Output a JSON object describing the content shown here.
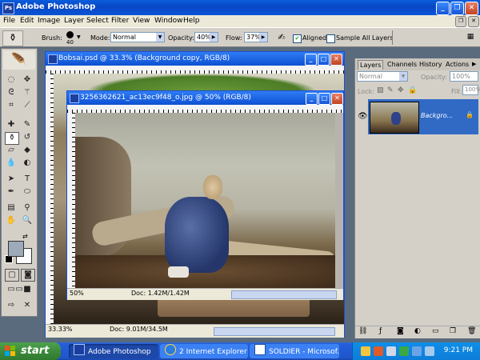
{
  "app": {
    "title": "Adobe Photoshop",
    "icon": "photoshop-icon"
  },
  "menu": [
    "File",
    "Edit",
    "Image",
    "Layer",
    "Select",
    "Filter",
    "View",
    "Window",
    "Help"
  ],
  "options": {
    "brush_label": "Brush:",
    "brush_size": "40",
    "mode_label": "Mode:",
    "mode_value": "Normal",
    "opacity_label": "Opacity:",
    "opacity_value": "40%",
    "flow_label": "Flow:",
    "flow_value": "37%",
    "aligned_label": "Aligned",
    "aligned_checked": true,
    "sample_all_label": "Sample All Layers",
    "sample_all_checked": false
  },
  "doc_back": {
    "title": "Bobsai.psd @ 33.3% (Background copy, RGB/8)",
    "zoom": "33.33%",
    "doc_info": "Doc: 9.01M/34.5M"
  },
  "doc_front": {
    "title": "3256362621_ac13ec9f48_o.jpg @ 50% (RGB/8)",
    "zoom": "50%",
    "doc_info": "Doc: 1.42M/1.42M"
  },
  "layers_panel": {
    "tabs": [
      "Layers",
      "Channels",
      "History",
      "Actions"
    ],
    "active_tab": "Layers",
    "blend_mode": "Normal",
    "opacity_label": "Opacity:",
    "opacity_value": "100%",
    "lock_label": "Lock:",
    "fill_label": "Fill:",
    "fill_value": "100%",
    "layer_name": "Backgro..."
  },
  "taskbar": {
    "start_label": "start",
    "tasks": [
      {
        "label": "Adobe Photoshop",
        "active": true,
        "icon": "photoshop-icon"
      },
      {
        "label": "2 Internet Explorer",
        "active": false,
        "icon": "internet-explorer-icon"
      },
      {
        "label": "SOLDIER - Microsof...",
        "active": false,
        "icon": "word-document-icon"
      }
    ],
    "clock": "9:21 PM"
  },
  "colors": {
    "xp_blue": "#0a55d8",
    "taskbar_active": "#1e48a8",
    "selection": "#316ac5",
    "start_green": "#3c8a3c"
  }
}
